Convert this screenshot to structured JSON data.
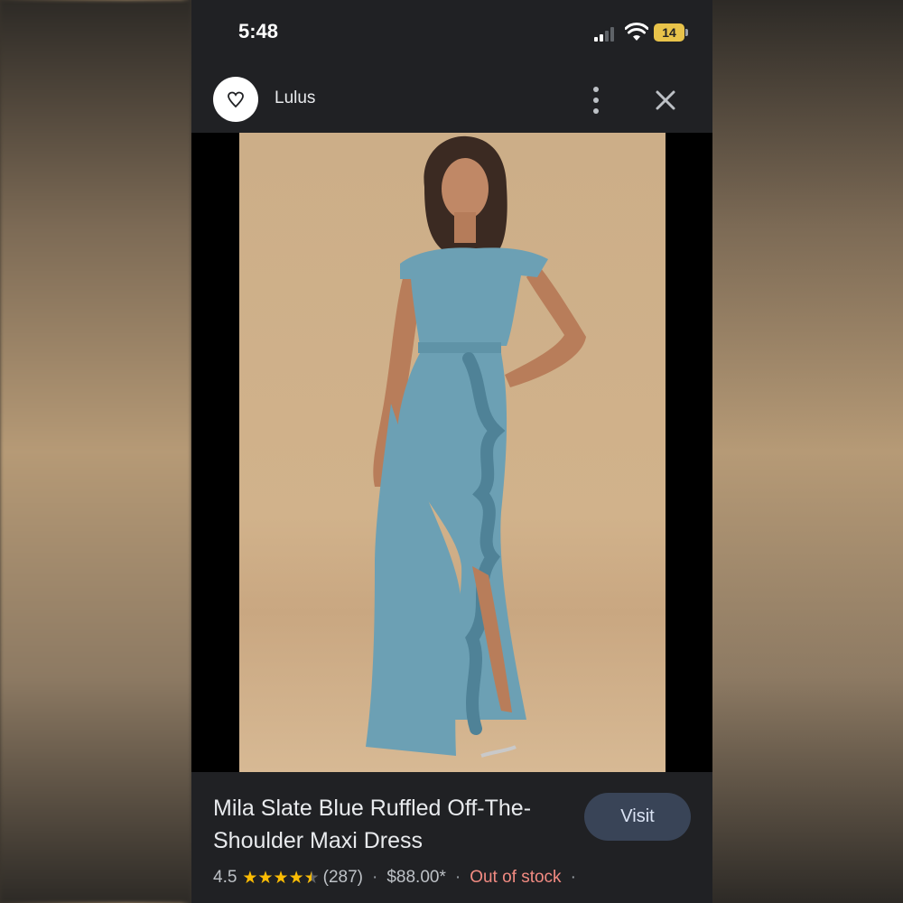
{
  "status_bar": {
    "time": "5:48",
    "battery": "14"
  },
  "app_bar": {
    "site_name": "Lulus",
    "logo_icon": "heart-logo-icon"
  },
  "product": {
    "title": "Mila Slate Blue Ruffled Off-The-Shoulder Maxi Dress",
    "rating": "4.5",
    "rating_stars": 4.5,
    "review_count": "(287)",
    "price": "$88.00*",
    "stock": "Out of stock",
    "separator": "·"
  },
  "actions": {
    "visit_label": "Visit"
  },
  "colors": {
    "accent": "#394457",
    "star": "#fbbc04",
    "stock": "#f28b82",
    "background": "#202124"
  }
}
